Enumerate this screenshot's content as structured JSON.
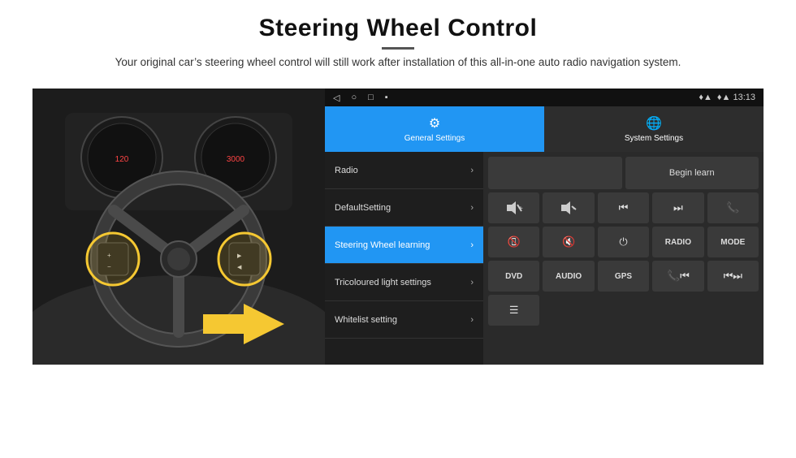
{
  "header": {
    "title": "Steering Wheel Control",
    "divider": true,
    "subtitle": "Your original car’s steering wheel control will still work after installation of this all-in-one auto radio navigation system."
  },
  "status_bar": {
    "left_icons": [
      "◁",
      "○",
      "□",
      "▪"
    ],
    "right_icons": "♦▲ 13:13"
  },
  "tabs": [
    {
      "id": "general",
      "label": "General Settings",
      "icon": "⚙",
      "active": true
    },
    {
      "id": "system",
      "label": "System Settings",
      "icon": "🌐",
      "active": false
    }
  ],
  "menu_items": [
    {
      "id": "radio",
      "label": "Radio",
      "active": false
    },
    {
      "id": "default",
      "label": "DefaultSetting",
      "active": false
    },
    {
      "id": "steering",
      "label": "Steering Wheel learning",
      "active": true
    },
    {
      "id": "tricolour",
      "label": "Tricoloured light settings",
      "active": false
    },
    {
      "id": "whitelist",
      "label": "Whitelist setting",
      "active": false
    }
  ],
  "learning_panel": {
    "begin_learn_label": "Begin learn",
    "grid_buttons": [
      {
        "icon": "🔊+",
        "type": "icon"
      },
      {
        "icon": "🔊-",
        "type": "icon"
      },
      {
        "icon": "⏮",
        "type": "icon"
      },
      {
        "icon": "⏭",
        "type": "icon"
      },
      {
        "icon": "📞",
        "type": "icon"
      },
      {
        "icon": "📞",
        "type": "icon"
      },
      {
        "icon": "🔇",
        "type": "icon"
      },
      {
        "icon": "⏻",
        "type": "icon"
      },
      {
        "icon": "RADIO",
        "type": "text"
      },
      {
        "icon": "MODE",
        "type": "text"
      },
      {
        "icon": "DVD",
        "type": "text"
      },
      {
        "icon": "AUDIO",
        "type": "text"
      },
      {
        "icon": "GPS",
        "type": "text"
      },
      {
        "icon": "📞⏮",
        "type": "icon"
      },
      {
        "icon": "⏮⏭",
        "type": "icon"
      },
      {
        "icon": "📋",
        "type": "icon"
      }
    ]
  }
}
